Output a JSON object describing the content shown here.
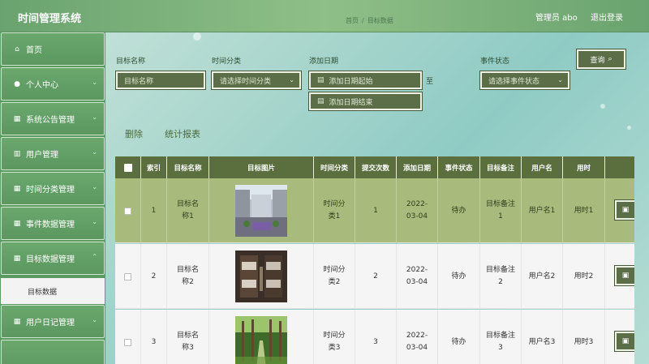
{
  "header": {
    "app_title": "时间管理系统",
    "breadcrumb": [
      "首页",
      "/",
      "目标数据"
    ],
    "admin_label": "管理员 abo",
    "logout_label": "退出登录"
  },
  "sidebar": {
    "items": [
      {
        "label": "首页",
        "icon": "home-icon",
        "chevron": false
      },
      {
        "label": "个人中心",
        "icon": "user-icon",
        "chevron": true
      },
      {
        "label": "系统公告管理",
        "icon": "grid-icon",
        "chevron": true
      },
      {
        "label": "用户管理",
        "icon": "users-icon",
        "chevron": true
      },
      {
        "label": "时间分类管理",
        "icon": "grid-icon",
        "chevron": true
      },
      {
        "label": "事件数据管理",
        "icon": "grid-icon",
        "chevron": true
      },
      {
        "label": "目标数据管理",
        "icon": "grid-icon",
        "chevron": true
      },
      {
        "label": "用户日记管理",
        "icon": "grid-icon",
        "chevron": true
      }
    ],
    "sub_item": "目标数据"
  },
  "search": {
    "target_name_label": "目标名称",
    "target_name_placeholder": "目标名称",
    "time_category_label": "时间分类",
    "time_category_placeholder": "请选择时间分类",
    "add_date_label": "添加日期",
    "date_start_placeholder": "添加日期起始",
    "date_to": "至",
    "date_end_placeholder": "添加日期结束",
    "event_status_label": "事件状态",
    "event_status_placeholder": "请选择事件状态",
    "search_button": "查询"
  },
  "actions": {
    "delete": "删除",
    "report": "统计报表"
  },
  "table": {
    "headers": [
      "",
      "索引",
      "目标名称",
      "目标图片",
      "时间分类",
      "提交次数",
      "添加日期",
      "事件状态",
      "目标备注",
      "用户名",
      "用时"
    ],
    "rows": [
      {
        "index": "1",
        "name": "目标名称1",
        "category": "时间分类1",
        "count": "1",
        "date": "2022-03-04",
        "status": "待办",
        "note": "目标备注1",
        "user": "用户名1",
        "used": "用时1",
        "selected": true
      },
      {
        "index": "2",
        "name": "目标名称2",
        "category": "时间分类2",
        "count": "2",
        "date": "2022-03-04",
        "status": "待办",
        "note": "目标备注2",
        "user": "用户名2",
        "used": "用时2",
        "selected": false
      },
      {
        "index": "3",
        "name": "目标名称3",
        "category": "时间分类3",
        "count": "3",
        "date": "2022-03-04",
        "status": "待办",
        "note": "目标备注3",
        "user": "用户名3",
        "used": "用时3",
        "selected": false
      }
    ]
  },
  "colors": {
    "header_green": "#6aa36f",
    "sidebar_green": "#5c9a62",
    "control_olive": "#5b6e48",
    "table_head": "#5a6e3e",
    "selected_row": "#a9bb7c"
  }
}
